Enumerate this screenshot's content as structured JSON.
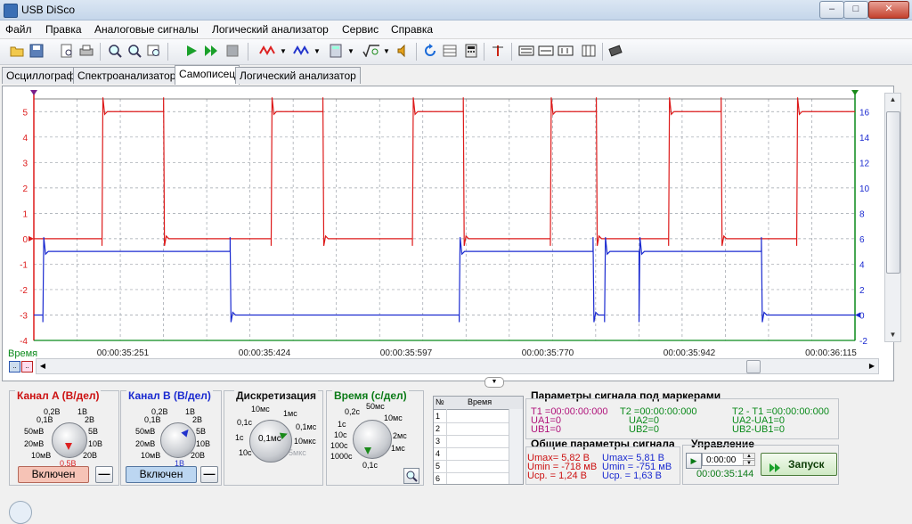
{
  "window": {
    "title": "USB DiSco",
    "controls": {
      "minimize": "–",
      "maximize": "□",
      "close": "✕"
    }
  },
  "menu": [
    "Файл",
    "Правка",
    "Аналоговые сигналы",
    "Логический анализатор",
    "Сервис",
    "Справка"
  ],
  "toolbar_icons": [
    "open-icon",
    "save-icon",
    "print-preview-icon",
    "print-icon",
    "zoom-in-icon",
    "zoom-out-icon",
    "zoom-fit-icon",
    "play-icon",
    "play-step-icon",
    "stop-icon",
    "channel-a-wave-icon",
    "channel-b-wave-icon",
    "calculator-icon",
    "math-sqrt-icon",
    "sound-icon",
    "refresh-icon",
    "table-icon",
    "calc2-icon",
    "marker-icon",
    "spi-icon",
    "i2c-icon",
    "uart-icon",
    "chip-icon"
  ],
  "tabs": [
    "Осциллограф",
    "Спектроанализатор",
    "Самописец",
    "Логический анализатор"
  ],
  "active_tab": "Самописец",
  "colors": {
    "channel_a": "#dd1a1a",
    "channel_b": "#1a2ad0",
    "grid": "#9aa0a8",
    "time_axis": "#0a8a1a"
  },
  "plot": {
    "time_axis_label": "Время",
    "time_ticks": [
      "00:00:35:251",
      "00:00:35:424",
      "00:00:35:597",
      "00:00:35:770",
      "00:00:35:942",
      "00:00:36:115"
    ],
    "left_ticks": [
      "5",
      "4",
      "3",
      "2",
      "1",
      "0",
      "-1",
      "-2",
      "-3",
      "-4"
    ],
    "right_ticks": [
      "16",
      "14",
      "12",
      "10",
      "8",
      "6",
      "4",
      "2",
      "0",
      "-2"
    ]
  },
  "chart_data": {
    "type": "line",
    "xlabel": "Время",
    "x_unit": "time (hh:mm:ss:ms)",
    "x_ticks": [
      "00:00:35:251",
      "00:00:35:424",
      "00:00:35:597",
      "00:00:35:770",
      "00:00:35:942",
      "00:00:36:115"
    ],
    "ylim_left": [
      -4,
      5.5
    ],
    "ylim_right": [
      -2,
      17
    ],
    "grid": true,
    "series": [
      {
        "name": "Канал A",
        "axis": "left",
        "low": 0.0,
        "high": 5.0,
        "edges": [
          [
            "0.083",
            "up"
          ],
          [
            "0.158",
            "down"
          ],
          [
            "0.289",
            "up"
          ],
          [
            "0.352",
            "down"
          ],
          [
            "0.461",
            "up"
          ],
          [
            "0.523",
            "down"
          ],
          [
            "0.629",
            "up"
          ],
          [
            "0.685",
            "down"
          ],
          [
            "0.773",
            "up"
          ],
          [
            "0.837",
            "down"
          ],
          [
            "0.929",
            "up"
          ]
        ]
      },
      {
        "name": "Канал B",
        "axis": "right",
        "low": 0.0,
        "high": 5.0,
        "edges": [
          [
            "0.011",
            "up"
          ],
          [
            "0.239",
            "down"
          ],
          [
            "0.518",
            "up"
          ],
          [
            "0.681",
            "down"
          ],
          [
            "0.695",
            "up"
          ],
          [
            "0.737",
            "up"
          ],
          [
            "0.886",
            "down"
          ]
        ]
      }
    ]
  },
  "channel_a": {
    "title": "Канал A (В/дел)",
    "scale_labels": [
      "0,2В",
      "0,1В",
      "50мВ",
      "20мВ",
      "10мВ",
      "1В",
      "2В",
      "5В",
      "10В",
      "20В"
    ],
    "selected": "0,5В",
    "toggle_label": "Включен",
    "minus": "—"
  },
  "channel_b": {
    "title": "Канал B (В/дел)",
    "scale_labels": [
      "0,2В",
      "0,1В",
      "50мВ",
      "20мВ",
      "10мВ",
      "1В",
      "2В",
      "5В",
      "10В",
      "20В"
    ],
    "selected": "1В",
    "toggle_label": "Включен",
    "minus": "—"
  },
  "sampling": {
    "title": "Дискретизация",
    "scale_labels": [
      "10мс",
      "1мс",
      "0,1мс",
      "10мкс",
      "5мкс",
      "0,1с",
      "1с",
      "10с",
      "0,1мс"
    ],
    "selected": "0,1мс"
  },
  "time_div": {
    "title": "Время (с/дел)",
    "scale_labels": [
      "0,2с",
      "50мс",
      "10мс",
      "1с",
      "2мс",
      "10с",
      "1мс",
      "100с",
      "1000с"
    ],
    "selected": "0,1с"
  },
  "marker_table": {
    "col_num": "№",
    "col_time": "Время",
    "rows": [
      "1",
      "2",
      "3",
      "4",
      "5",
      "6"
    ]
  },
  "marker_params": {
    "title": "Параметры сигнала под маркерами",
    "t1": "T1 =00:00:00:000",
    "t2": "T2 =00:00:00:000",
    "dt": "T2 - T1 =00:00:00:000",
    "ua1": "UA1=0",
    "ub1": "UB1=0",
    "ua2": "UA2=0",
    "ub2": "UB2=0",
    "dua": "UA2-UA1=0",
    "dub": "UB2-UB1=0"
  },
  "general_params": {
    "title": "Общие параметры сигнала",
    "a": {
      "umax": "Umax= 5,82 В",
      "umin": "Umin = -718 мВ",
      "ucp": "Uср. = 1,24 В"
    },
    "b": {
      "umax": "Umax= 5,81 В",
      "umin": "Umin = -751 мВ",
      "ucp": "Uср. = 1,63 В"
    }
  },
  "control": {
    "title": "Управление",
    "time_value": "0:00:00",
    "elapsed": "00:00:35:144",
    "start_label": "Запуск"
  }
}
